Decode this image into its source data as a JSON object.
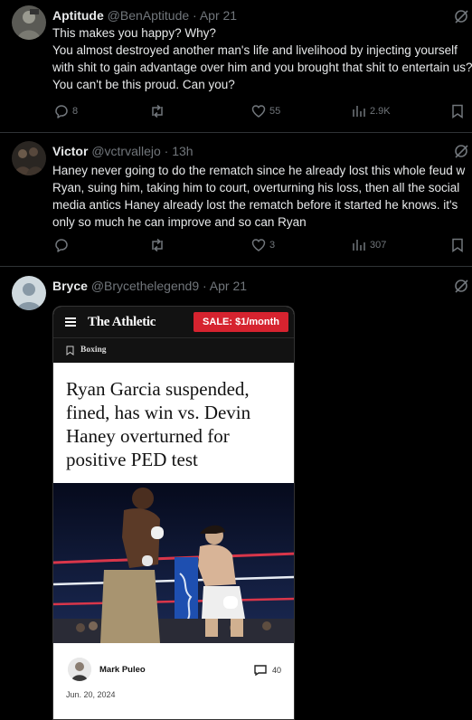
{
  "posts": [
    {
      "name": "Aptitude",
      "handle": "@BenAptitude",
      "time": "· Apr 21",
      "body": "This makes you happy? Why?\nYou almost destroyed another man's life and livelihood by injecting yourself with shit to gain advantage over him and you brought that shit to entertain us? You can't be this proud. Can you?",
      "replies": "8",
      "reposts": "",
      "likes": "55",
      "views": "2.9K"
    },
    {
      "name": "Victor",
      "handle": "@vctrvallejo",
      "time": "· 13h",
      "body": "Haney never going to do the rematch since he already lost this whole feud w Ryan, suing him, taking him to court, overturning his loss, then all the social media antics Haney already lost the rematch before it started he knows. it's only so much he can improve and so can Ryan",
      "replies": "",
      "reposts": "",
      "likes": "3",
      "views": "307"
    },
    {
      "name": "Bryce",
      "handle": "@Brycethelegend9",
      "time": "· Apr 21"
    }
  ],
  "card": {
    "brand": "The Athletic",
    "sale": "SALE: $1/month",
    "section": "Boxing",
    "headline": "Ryan Garcia suspended, fined, has win vs. Devin Haney overturned for positive PED test",
    "author": "Mark Puleo",
    "date": "Jun. 20, 2024",
    "comments": "40"
  },
  "colors": {
    "background": "#000000",
    "muted": "#71767b",
    "divider": "#2f3336",
    "sale_red": "#d6232f"
  },
  "icons": [
    "reply-icon",
    "repost-icon",
    "like-icon",
    "views-icon",
    "bookmark-icon",
    "grok-icon",
    "menu-icon",
    "comment-icon"
  ]
}
